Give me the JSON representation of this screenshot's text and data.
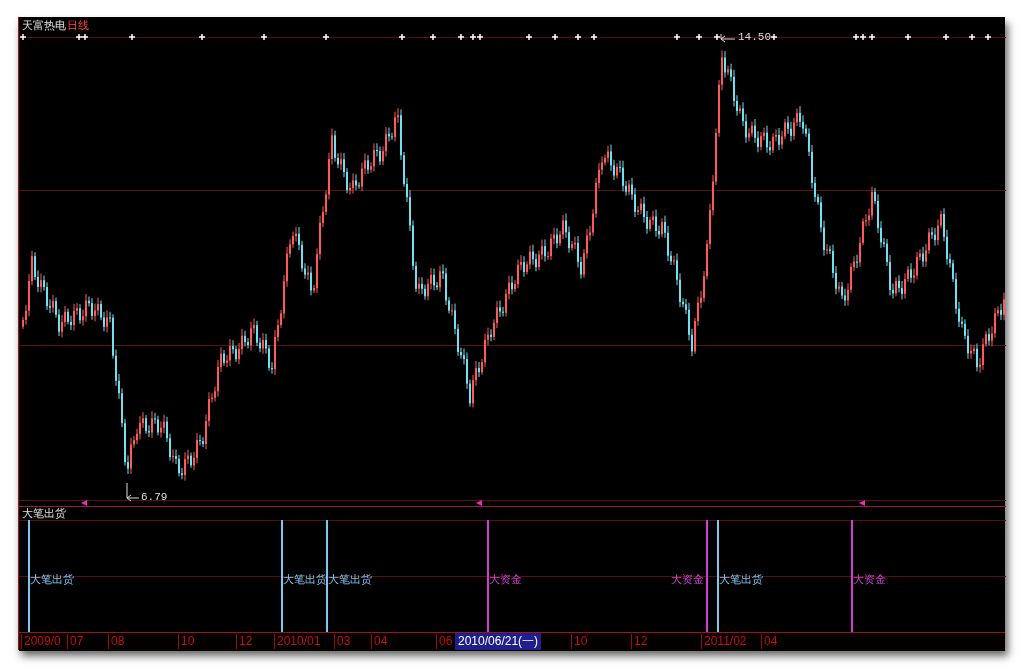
{
  "header": {
    "stock_name": "天富热电",
    "period": "日线"
  },
  "price_labels": {
    "high": "14.50",
    "low": "6.79"
  },
  "indicator": {
    "title": "大笔出货",
    "signals": [
      {
        "kind": "sell",
        "label": "大笔出货"
      },
      {
        "kind": "sell",
        "label": "大笔出货"
      },
      {
        "kind": "sell",
        "label": "大笔出货"
      },
      {
        "kind": "fund",
        "label": "大资金"
      },
      {
        "kind": "fund",
        "label": "大资金"
      },
      {
        "kind": "sell",
        "label": "大笔出货"
      },
      {
        "kind": "fund",
        "label": "大资金"
      }
    ]
  },
  "date_axis": {
    "labels": [
      "2009/0",
      "07",
      "08",
      "10",
      "12",
      "2010/01",
      "03",
      "04",
      "06",
      "10",
      "12",
      "2011/02",
      "04"
    ],
    "cursor_date": "2010/06/21(一)"
  }
}
